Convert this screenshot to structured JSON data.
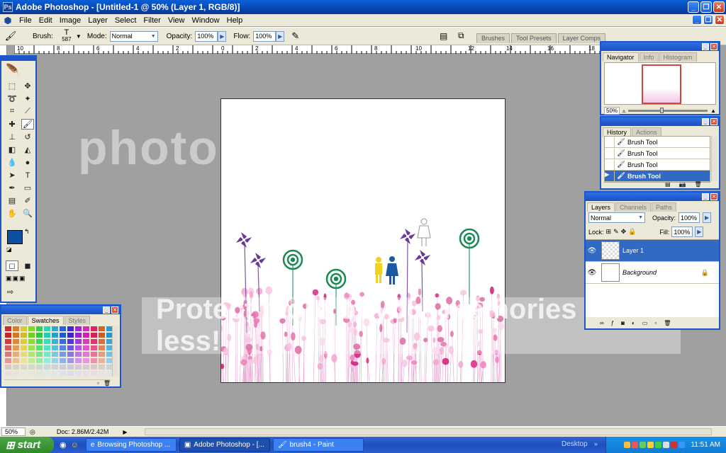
{
  "window": {
    "title": "Adobe Photoshop - [Untitled-1 @ 50% (Layer 1, RGB/8)]"
  },
  "menu": [
    "File",
    "Edit",
    "Image",
    "Layer",
    "Select",
    "Filter",
    "View",
    "Window",
    "Help"
  ],
  "options": {
    "brush_label": "Brush:",
    "brush_size": "587",
    "mode_label": "Mode:",
    "mode_value": "Normal",
    "opacity_label": "Opacity:",
    "opacity_value": "100%",
    "flow_label": "Flow:",
    "flow_value": "100%",
    "wells": [
      "Brushes",
      "Tool Presets",
      "Layer Comps"
    ]
  },
  "ruler": {
    "marks": [
      "10",
      "8",
      "6",
      "4",
      "2",
      "0",
      "2",
      "4",
      "6",
      "8",
      "10",
      "12",
      "14",
      "16",
      "18"
    ]
  },
  "watermark": {
    "logo": "photobucket",
    "tagline": "Protect more of your memories for less!"
  },
  "navigator": {
    "tabs": [
      "Navigator",
      "Info",
      "Histogram"
    ],
    "zoom": "50%"
  },
  "history": {
    "tabs": [
      "History",
      "Actions"
    ],
    "items": [
      "Brush Tool",
      "Brush Tool",
      "Brush Tool",
      "Brush Tool"
    ]
  },
  "layers": {
    "tabs": [
      "Layers",
      "Channels",
      "Paths"
    ],
    "blend_mode": "Normal",
    "opacity_label": "Opacity:",
    "opacity": "100%",
    "lock_label": "Lock:",
    "fill_label": "Fill:",
    "fill": "100%",
    "items": [
      {
        "name": "Layer 1"
      },
      {
        "name": "Background"
      }
    ]
  },
  "swatches": {
    "tabs": [
      "Color",
      "Swatches",
      "Styles"
    ]
  },
  "status": {
    "zoom": "50%",
    "doc": "Doc: 2.86M/2.42M"
  },
  "taskbar": {
    "start": "start",
    "buttons": [
      "Browsing Photoshop ...",
      "Adobe Photoshop - [...",
      "brush4 - Paint"
    ],
    "desktop": "Desktop",
    "clock": "11:51 AM"
  },
  "colors": {
    "foreground": "#0a4fa0",
    "background": "#ffffff",
    "accent": "#1b57c9"
  }
}
